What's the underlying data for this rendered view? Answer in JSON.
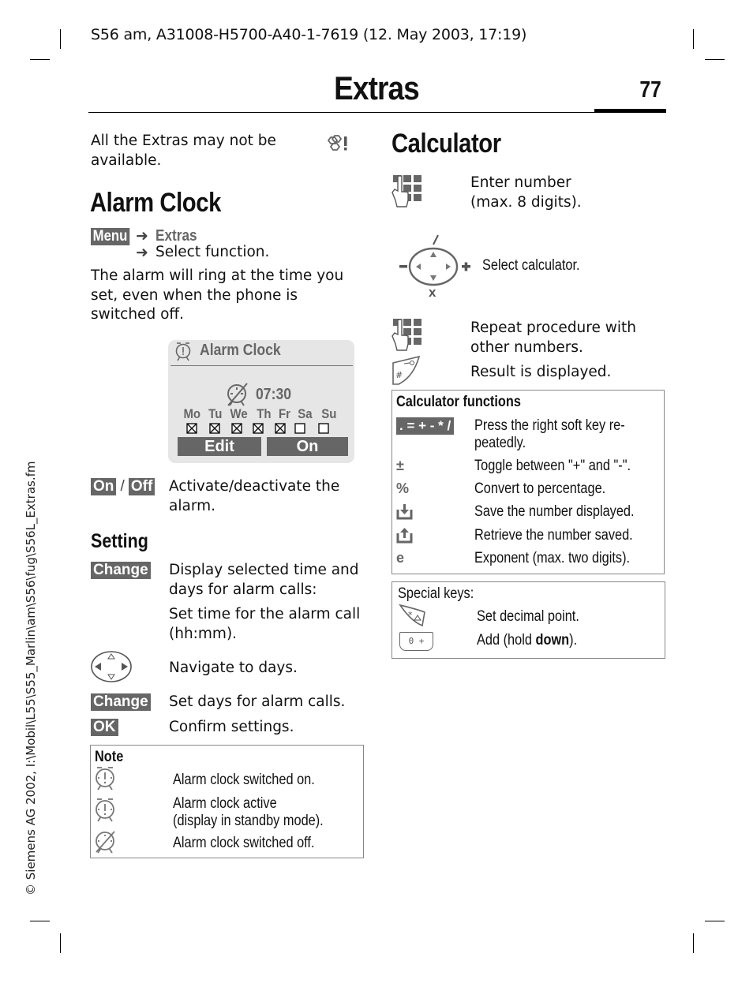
{
  "header": {
    "doc_info": "S56 am, A31008-H5700-A40-1-7619 (12. May 2003, 17:19)",
    "chapter_title": "Extras",
    "page_number": "77"
  },
  "side_note": "© Siemens AG 2002, I:\\Mobil\\L55\\S55_Marlin\\am\\S56\\fug\\S56L_Extras.fm",
  "left": {
    "availability_note": [
      "All the Extras may not be",
      "available."
    ],
    "availability_icon": "network-dependent-icon",
    "alarm_clock": {
      "heading": "Alarm Clock",
      "menu_path": {
        "key": "Menu",
        "step1": "Extras",
        "step2": "Select function."
      },
      "description": [
        "The alarm will ring at the time you",
        "set, even when the phone is",
        "switched off."
      ],
      "display": {
        "title": "Alarm Clock",
        "time": "07:30",
        "days": [
          {
            "label": "Mo",
            "checked": true
          },
          {
            "label": "Tu",
            "checked": true
          },
          {
            "label": "We",
            "checked": true
          },
          {
            "label": "Th",
            "checked": true
          },
          {
            "label": "Fr",
            "checked": true
          },
          {
            "label": "Sa",
            "checked": false
          },
          {
            "label": "Su",
            "checked": false
          }
        ],
        "softkey_left": "Edit",
        "softkey_right": "On"
      },
      "on_off": {
        "on": "On",
        "sep": "/",
        "off": "Off",
        "text": [
          "Activate/deactivate the",
          "alarm."
        ]
      },
      "setting": {
        "heading": "Setting",
        "rows": [
          {
            "key": "Change",
            "text": [
              "Display selected time and",
              "days for alarm calls:"
            ]
          },
          {
            "key": "",
            "text": [
              "Set time for the alarm call",
              "(hh:mm)."
            ]
          },
          {
            "key_icon": "navigation-key-icon",
            "text": [
              "Navigate to days."
            ]
          },
          {
            "key": "Change",
            "text": [
              "Set days for alarm calls."
            ]
          },
          {
            "key": "OK",
            "text": [
              "Confirm settings."
            ]
          }
        ]
      },
      "note": {
        "heading": "Note",
        "items": [
          {
            "icon": "alarm-on-icon",
            "text": [
              "Alarm clock switched on."
            ]
          },
          {
            "icon": "alarm-active-icon",
            "text": [
              "Alarm clock active",
              "(display in standby mode)."
            ]
          },
          {
            "icon": "alarm-off-icon",
            "text": [
              "Alarm clock switched off."
            ]
          }
        ]
      }
    }
  },
  "right": {
    "calculator": {
      "heading": "Calculator",
      "steps": [
        {
          "icon": "keypad-icon",
          "text": [
            "Enter number",
            "(max. 8 digits)."
          ]
        },
        {
          "icon": "control-key-icon",
          "text": [
            "Select calculator."
          ],
          "control_labels": {
            "top": "/",
            "left": "-",
            "right": "+",
            "bottom": "x"
          }
        },
        {
          "icon": "keypad-icon",
          "text": [
            "Repeat procedure with",
            "other numbers."
          ]
        },
        {
          "icon": "hash-key-icon",
          "text": [
            "Result is displayed."
          ]
        }
      ],
      "functions": {
        "heading": "Calculator functions",
        "rows": [
          {
            "symbol": ". = + - * /",
            "text": [
              "Press the right soft key re-",
              "peatedly."
            ]
          },
          {
            "symbol": "±",
            "text": [
              "Toggle between \"+\" and \"-\"."
            ]
          },
          {
            "symbol": "%",
            "text": [
              "Convert to percentage."
            ]
          },
          {
            "symbol_icon": "save-number-icon",
            "text": [
              "Save the number displayed."
            ]
          },
          {
            "symbol_icon": "retrieve-number-icon",
            "text": [
              "Retrieve the number saved."
            ]
          },
          {
            "symbol": "e",
            "text": [
              "Exponent (max. two digits)."
            ]
          }
        ]
      },
      "special_keys": {
        "heading": "Special keys:",
        "rows": [
          {
            "icon": "star-key-icon",
            "text": "Set decimal point."
          },
          {
            "icon": "zero-key-icon",
            "key_label": "0 +",
            "text_prefix": "Add (hold ",
            "text_bold": "down",
            "text_suffix": ")."
          }
        ]
      }
    }
  }
}
